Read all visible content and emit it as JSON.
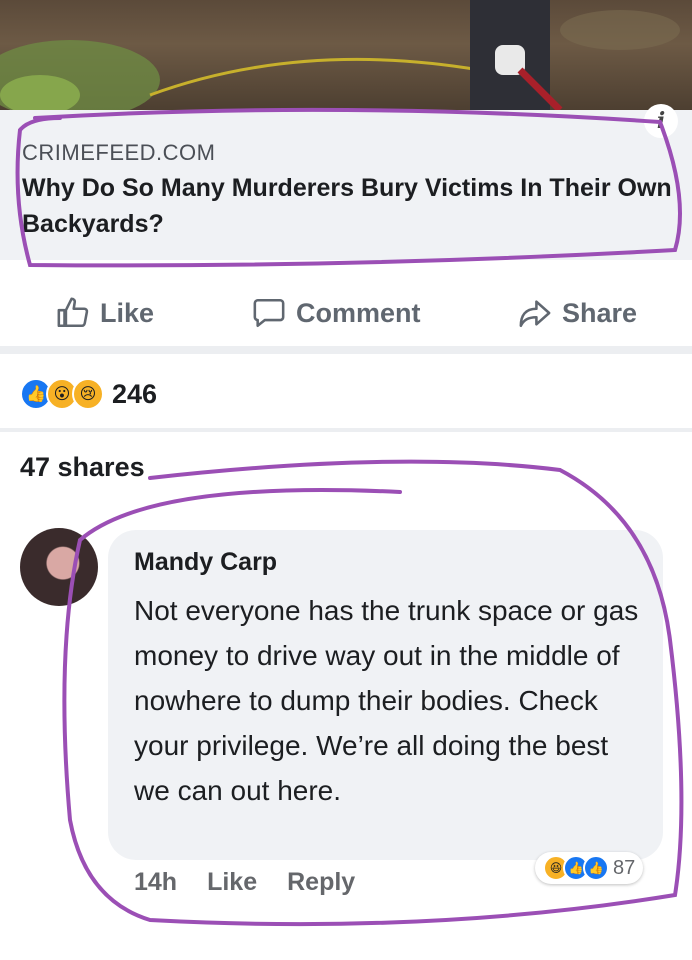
{
  "post": {
    "site": "CRIMEFEED.COM",
    "headline": "Why Do So Many Murderers Bury Victims In Their Own Backyards?",
    "info_icon": "info-icon"
  },
  "actions": {
    "like": "Like",
    "comment": "Comment",
    "share": "Share"
  },
  "stats": {
    "reaction_count": "246",
    "shares": "47 shares"
  },
  "comment": {
    "author": "Mandy Carp",
    "text": "Not everyone has the trunk space or gas money to drive way out in the middle of nowhere to dump their bodies. Check your privilege. We’re all doing the best we can out here.",
    "time": "14h",
    "like": "Like",
    "reply": "Reply",
    "reaction_count": "87"
  },
  "colors": {
    "fb_blue": "#1877f2",
    "marker": "#9b4fb5",
    "text_gray": "#606770"
  }
}
